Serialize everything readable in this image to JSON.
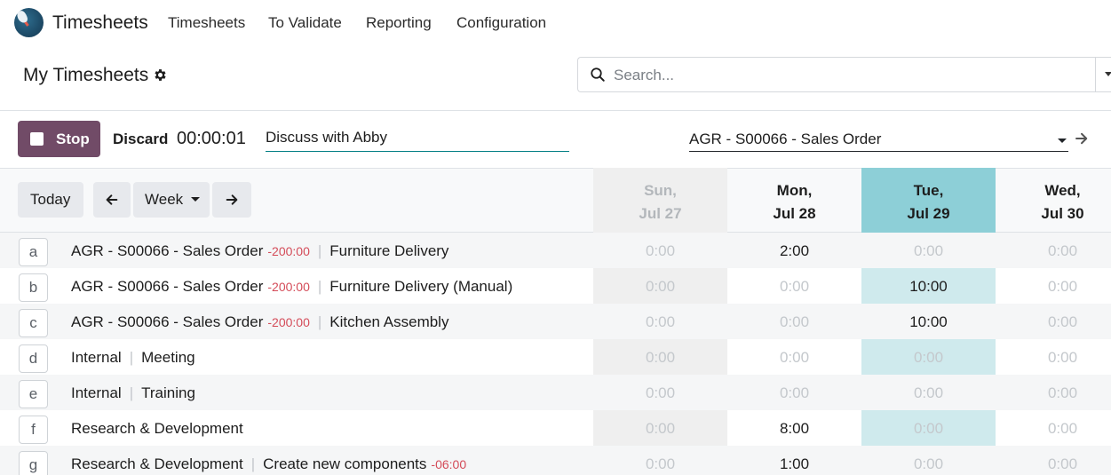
{
  "app": {
    "name": "Timesheets",
    "menu": [
      "Timesheets",
      "To Validate",
      "Reporting",
      "Configuration"
    ]
  },
  "control_panel": {
    "title": "My Timesheets",
    "search_placeholder": "Search..."
  },
  "timer": {
    "stop_label": "Stop",
    "discard_label": "Discard",
    "elapsed": "00:00:01",
    "description": "Discuss with Abby",
    "project": "AGR - S00066 - Sales Order"
  },
  "grid": {
    "today_label": "Today",
    "range_label": "Week",
    "days": [
      {
        "dow": "Sun,",
        "date": "Jul 27"
      },
      {
        "dow": "Mon,",
        "date": "Jul 28"
      },
      {
        "dow": "Tue,",
        "date": "Jul 29"
      },
      {
        "dow": "Wed,",
        "date": "Jul 30"
      }
    ],
    "rows": [
      {
        "key": "a",
        "project": "AGR - S00066 - Sales Order",
        "remaining": "-200:00",
        "task": "Furniture Delivery",
        "hours": [
          "0:00",
          "2:00",
          "0:00",
          "0:00"
        ]
      },
      {
        "key": "b",
        "project": "AGR - S00066 - Sales Order",
        "remaining": "-200:00",
        "task": "Furniture Delivery (Manual)",
        "hours": [
          "0:00",
          "0:00",
          "10:00",
          "0:00"
        ]
      },
      {
        "key": "c",
        "project": "AGR - S00066 - Sales Order",
        "remaining": "-200:00",
        "task": "Kitchen Assembly",
        "hours": [
          "0:00",
          "0:00",
          "10:00",
          "0:00"
        ]
      },
      {
        "key": "d",
        "project": "Internal",
        "remaining": "",
        "task": "Meeting",
        "hours": [
          "0:00",
          "0:00",
          "0:00",
          "0:00"
        ]
      },
      {
        "key": "e",
        "project": "Internal",
        "remaining": "",
        "task": "Training",
        "hours": [
          "0:00",
          "0:00",
          "0:00",
          "0:00"
        ]
      },
      {
        "key": "f",
        "project": "Research & Development",
        "remaining": "",
        "task": "",
        "hours": [
          "0:00",
          "8:00",
          "0:00",
          "0:00"
        ]
      },
      {
        "key": "g",
        "project": "Research & Development",
        "remaining": "-06:00",
        "task": "Create new components",
        "hours": [
          "0:00",
          "1:00",
          "0:00",
          "0:00"
        ],
        "remaining_after_task": true
      }
    ]
  },
  "colors": {
    "brand": "#714b67",
    "today_header": "#8dcfd7",
    "today_column": "#cfeaed",
    "weekend_column": "#efefef",
    "negative": "#d44c59"
  }
}
